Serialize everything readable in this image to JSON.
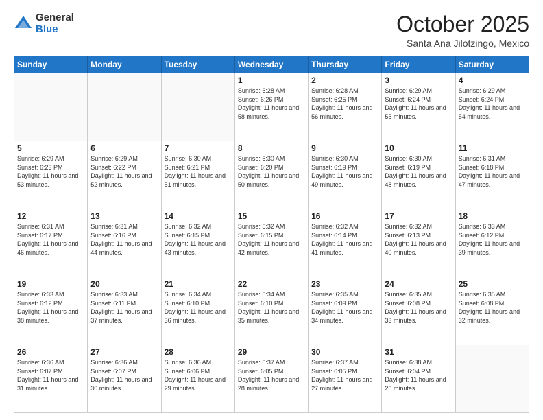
{
  "logo": {
    "general": "General",
    "blue": "Blue"
  },
  "header": {
    "month": "October 2025",
    "location": "Santa Ana Jilotzingo, Mexico"
  },
  "weekdays": [
    "Sunday",
    "Monday",
    "Tuesday",
    "Wednesday",
    "Thursday",
    "Friday",
    "Saturday"
  ],
  "weeks": [
    [
      {
        "day": "",
        "sunrise": "",
        "sunset": "",
        "daylight": ""
      },
      {
        "day": "",
        "sunrise": "",
        "sunset": "",
        "daylight": ""
      },
      {
        "day": "",
        "sunrise": "",
        "sunset": "",
        "daylight": ""
      },
      {
        "day": "1",
        "sunrise": "Sunrise: 6:28 AM",
        "sunset": "Sunset: 6:26 PM",
        "daylight": "Daylight: 11 hours and 58 minutes."
      },
      {
        "day": "2",
        "sunrise": "Sunrise: 6:28 AM",
        "sunset": "Sunset: 6:25 PM",
        "daylight": "Daylight: 11 hours and 56 minutes."
      },
      {
        "day": "3",
        "sunrise": "Sunrise: 6:29 AM",
        "sunset": "Sunset: 6:24 PM",
        "daylight": "Daylight: 11 hours and 55 minutes."
      },
      {
        "day": "4",
        "sunrise": "Sunrise: 6:29 AM",
        "sunset": "Sunset: 6:24 PM",
        "daylight": "Daylight: 11 hours and 54 minutes."
      }
    ],
    [
      {
        "day": "5",
        "sunrise": "Sunrise: 6:29 AM",
        "sunset": "Sunset: 6:23 PM",
        "daylight": "Daylight: 11 hours and 53 minutes."
      },
      {
        "day": "6",
        "sunrise": "Sunrise: 6:29 AM",
        "sunset": "Sunset: 6:22 PM",
        "daylight": "Daylight: 11 hours and 52 minutes."
      },
      {
        "day": "7",
        "sunrise": "Sunrise: 6:30 AM",
        "sunset": "Sunset: 6:21 PM",
        "daylight": "Daylight: 11 hours and 51 minutes."
      },
      {
        "day": "8",
        "sunrise": "Sunrise: 6:30 AM",
        "sunset": "Sunset: 6:20 PM",
        "daylight": "Daylight: 11 hours and 50 minutes."
      },
      {
        "day": "9",
        "sunrise": "Sunrise: 6:30 AM",
        "sunset": "Sunset: 6:19 PM",
        "daylight": "Daylight: 11 hours and 49 minutes."
      },
      {
        "day": "10",
        "sunrise": "Sunrise: 6:30 AM",
        "sunset": "Sunset: 6:19 PM",
        "daylight": "Daylight: 11 hours and 48 minutes."
      },
      {
        "day": "11",
        "sunrise": "Sunrise: 6:31 AM",
        "sunset": "Sunset: 6:18 PM",
        "daylight": "Daylight: 11 hours and 47 minutes."
      }
    ],
    [
      {
        "day": "12",
        "sunrise": "Sunrise: 6:31 AM",
        "sunset": "Sunset: 6:17 PM",
        "daylight": "Daylight: 11 hours and 46 minutes."
      },
      {
        "day": "13",
        "sunrise": "Sunrise: 6:31 AM",
        "sunset": "Sunset: 6:16 PM",
        "daylight": "Daylight: 11 hours and 44 minutes."
      },
      {
        "day": "14",
        "sunrise": "Sunrise: 6:32 AM",
        "sunset": "Sunset: 6:15 PM",
        "daylight": "Daylight: 11 hours and 43 minutes."
      },
      {
        "day": "15",
        "sunrise": "Sunrise: 6:32 AM",
        "sunset": "Sunset: 6:15 PM",
        "daylight": "Daylight: 11 hours and 42 minutes."
      },
      {
        "day": "16",
        "sunrise": "Sunrise: 6:32 AM",
        "sunset": "Sunset: 6:14 PM",
        "daylight": "Daylight: 11 hours and 41 minutes."
      },
      {
        "day": "17",
        "sunrise": "Sunrise: 6:32 AM",
        "sunset": "Sunset: 6:13 PM",
        "daylight": "Daylight: 11 hours and 40 minutes."
      },
      {
        "day": "18",
        "sunrise": "Sunrise: 6:33 AM",
        "sunset": "Sunset: 6:12 PM",
        "daylight": "Daylight: 11 hours and 39 minutes."
      }
    ],
    [
      {
        "day": "19",
        "sunrise": "Sunrise: 6:33 AM",
        "sunset": "Sunset: 6:12 PM",
        "daylight": "Daylight: 11 hours and 38 minutes."
      },
      {
        "day": "20",
        "sunrise": "Sunrise: 6:33 AM",
        "sunset": "Sunset: 6:11 PM",
        "daylight": "Daylight: 11 hours and 37 minutes."
      },
      {
        "day": "21",
        "sunrise": "Sunrise: 6:34 AM",
        "sunset": "Sunset: 6:10 PM",
        "daylight": "Daylight: 11 hours and 36 minutes."
      },
      {
        "day": "22",
        "sunrise": "Sunrise: 6:34 AM",
        "sunset": "Sunset: 6:10 PM",
        "daylight": "Daylight: 11 hours and 35 minutes."
      },
      {
        "day": "23",
        "sunrise": "Sunrise: 6:35 AM",
        "sunset": "Sunset: 6:09 PM",
        "daylight": "Daylight: 11 hours and 34 minutes."
      },
      {
        "day": "24",
        "sunrise": "Sunrise: 6:35 AM",
        "sunset": "Sunset: 6:08 PM",
        "daylight": "Daylight: 11 hours and 33 minutes."
      },
      {
        "day": "25",
        "sunrise": "Sunrise: 6:35 AM",
        "sunset": "Sunset: 6:08 PM",
        "daylight": "Daylight: 11 hours and 32 minutes."
      }
    ],
    [
      {
        "day": "26",
        "sunrise": "Sunrise: 6:36 AM",
        "sunset": "Sunset: 6:07 PM",
        "daylight": "Daylight: 11 hours and 31 minutes."
      },
      {
        "day": "27",
        "sunrise": "Sunrise: 6:36 AM",
        "sunset": "Sunset: 6:07 PM",
        "daylight": "Daylight: 11 hours and 30 minutes."
      },
      {
        "day": "28",
        "sunrise": "Sunrise: 6:36 AM",
        "sunset": "Sunset: 6:06 PM",
        "daylight": "Daylight: 11 hours and 29 minutes."
      },
      {
        "day": "29",
        "sunrise": "Sunrise: 6:37 AM",
        "sunset": "Sunset: 6:05 PM",
        "daylight": "Daylight: 11 hours and 28 minutes."
      },
      {
        "day": "30",
        "sunrise": "Sunrise: 6:37 AM",
        "sunset": "Sunset: 6:05 PM",
        "daylight": "Daylight: 11 hours and 27 minutes."
      },
      {
        "day": "31",
        "sunrise": "Sunrise: 6:38 AM",
        "sunset": "Sunset: 6:04 PM",
        "daylight": "Daylight: 11 hours and 26 minutes."
      },
      {
        "day": "",
        "sunrise": "",
        "sunset": "",
        "daylight": ""
      }
    ]
  ]
}
